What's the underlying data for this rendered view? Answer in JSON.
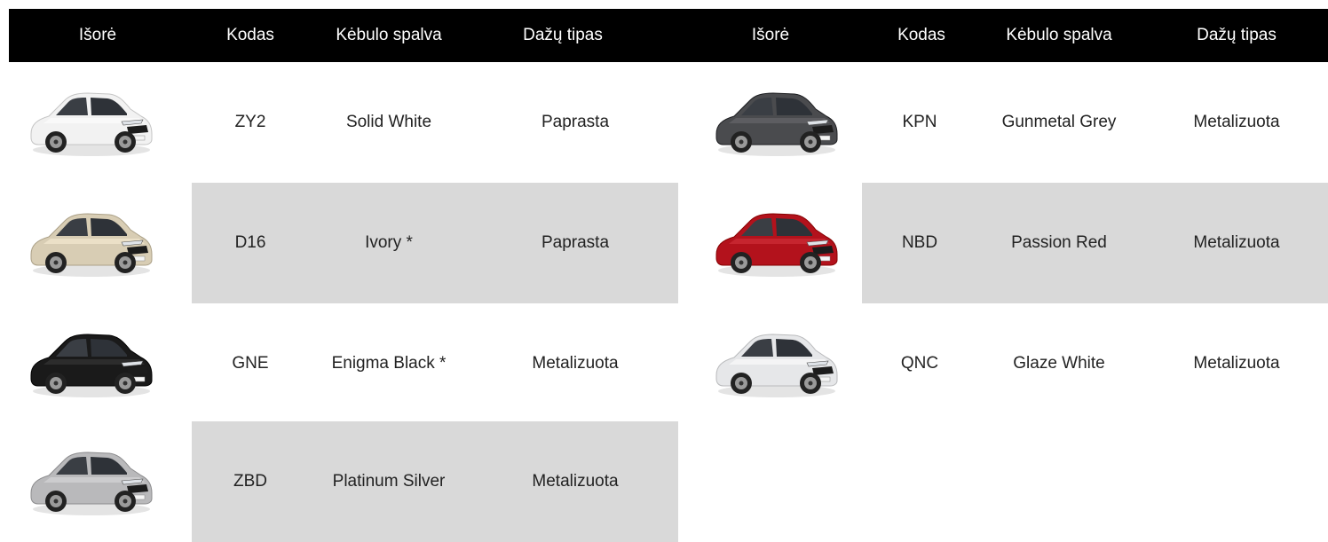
{
  "headers": {
    "left": [
      "Išorė",
      "Kodas",
      "Kėbulo spalva",
      "Dažų tipas"
    ],
    "right": [
      "Išorė",
      "Kodas",
      "Kėbulo spalva",
      "Dažų tipas"
    ]
  },
  "left_rows": [
    {
      "code": "ZY2",
      "color_name": "Solid White",
      "paint": "Paprasta",
      "car_color": "#f2f2f2",
      "image": "car-white-icon"
    },
    {
      "code": "D16",
      "color_name": "Ivory *",
      "paint": "Paprasta",
      "car_color": "#d8cdb4",
      "image": "car-ivory-icon"
    },
    {
      "code": "GNE",
      "color_name": "Enigma Black *",
      "paint": "Metalizuota",
      "car_color": "#1a1a1a",
      "image": "car-black-icon"
    },
    {
      "code": "ZBD",
      "color_name": "Platinum Silver",
      "paint": "Metalizuota",
      "car_color": "#b9b9bb",
      "image": "car-silver-icon"
    }
  ],
  "right_rows": [
    {
      "code": "KPN",
      "color_name": "Gunmetal Grey",
      "paint": "Metalizuota",
      "car_color": "#4a4b4e",
      "image": "car-grey-icon"
    },
    {
      "code": "NBD",
      "color_name": "Passion Red",
      "paint": "Metalizuota",
      "car_color": "#b3121c",
      "image": "car-red-icon"
    },
    {
      "code": "QNC",
      "color_name": "Glaze White",
      "paint": "Metalizuota",
      "car_color": "#e6e7e9",
      "image": "car-glaze-white-icon"
    }
  ],
  "colors": {
    "header_bg": "#000000",
    "header_text": "#ffffff",
    "shade": "#d9d9d9"
  }
}
